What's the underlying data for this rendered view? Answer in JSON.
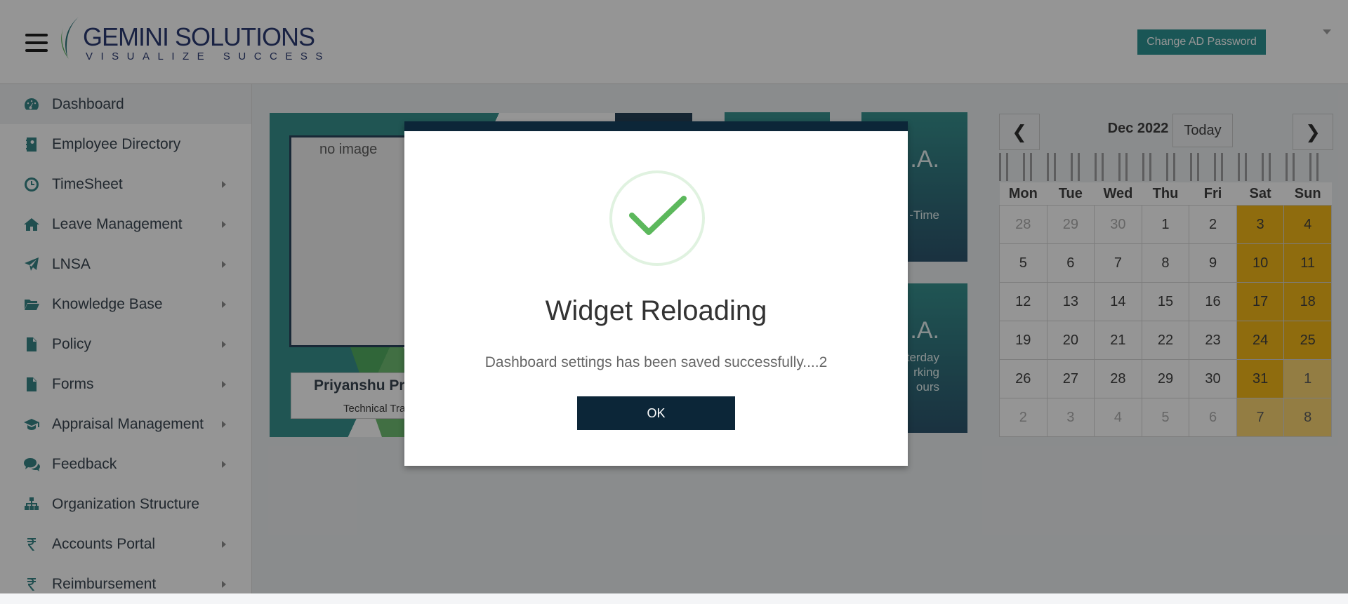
{
  "brand": {
    "name": "GEMINI SOLUTIONS",
    "tagline": "VISUALIZE SUCCESS"
  },
  "header": {
    "change_password_label": "Change AD Password"
  },
  "sidebar": {
    "items": [
      {
        "label": "Dashboard",
        "icon": "dashboard-icon"
      },
      {
        "label": "Employee Directory",
        "icon": "directory-icon"
      },
      {
        "label": "TimeSheet",
        "icon": "clock-icon"
      },
      {
        "label": "Leave Management",
        "icon": "home-icon"
      },
      {
        "label": "LNSA",
        "icon": "paper-plane-icon"
      },
      {
        "label": "Knowledge Base",
        "icon": "folder-icon"
      },
      {
        "label": "Policy",
        "icon": "document-icon"
      },
      {
        "label": "Forms",
        "icon": "document-icon"
      },
      {
        "label": "Appraisal Management",
        "icon": "graduation-cap-icon"
      },
      {
        "label": "Feedback",
        "icon": "comments-icon"
      },
      {
        "label": "Organization Structure",
        "icon": "sitemap-icon"
      },
      {
        "label": "Accounts Portal",
        "icon": "rupee-icon"
      },
      {
        "label": "Reimbursement",
        "icon": "rupee-icon"
      }
    ]
  },
  "profile": {
    "no_image_alt": "no image",
    "name": "Priyanshu Pr",
    "role": "Technical Tra"
  },
  "stats": [
    {
      "big": ".A.",
      "small": "-Time"
    },
    {
      "big": ".A.",
      "small": "terday|rking|ours"
    }
  ],
  "calendar": {
    "title": "Dec 2022",
    "today_label": "Today",
    "prev_label": "❮",
    "next_label": "❯",
    "weekdays": [
      "Mon",
      "Tue",
      "Wed",
      "Thu",
      "Fri",
      "Sat",
      "Sun"
    ],
    "weeks": [
      [
        "28",
        "29",
        "30",
        "1",
        "2",
        "3",
        "4"
      ],
      [
        "5",
        "6",
        "7",
        "8",
        "9",
        "10",
        "11"
      ],
      [
        "12",
        "13",
        "14",
        "15",
        "16",
        "17",
        "18"
      ],
      [
        "19",
        "20",
        "21",
        "22",
        "23",
        "24",
        "25"
      ],
      [
        "26",
        "27",
        "28",
        "29",
        "30",
        "31",
        "1"
      ],
      [
        "2",
        "3",
        "4",
        "5",
        "6",
        "7",
        "8"
      ]
    ]
  },
  "modal": {
    "title": "Widget Reloading",
    "message": "Dashboard settings has been saved successfully....2",
    "ok_label": "OK"
  },
  "colors": {
    "teal": "#2a8b88",
    "navy": "#0c2638",
    "weekend": "#f5b50a",
    "success": "#5cb85c"
  }
}
